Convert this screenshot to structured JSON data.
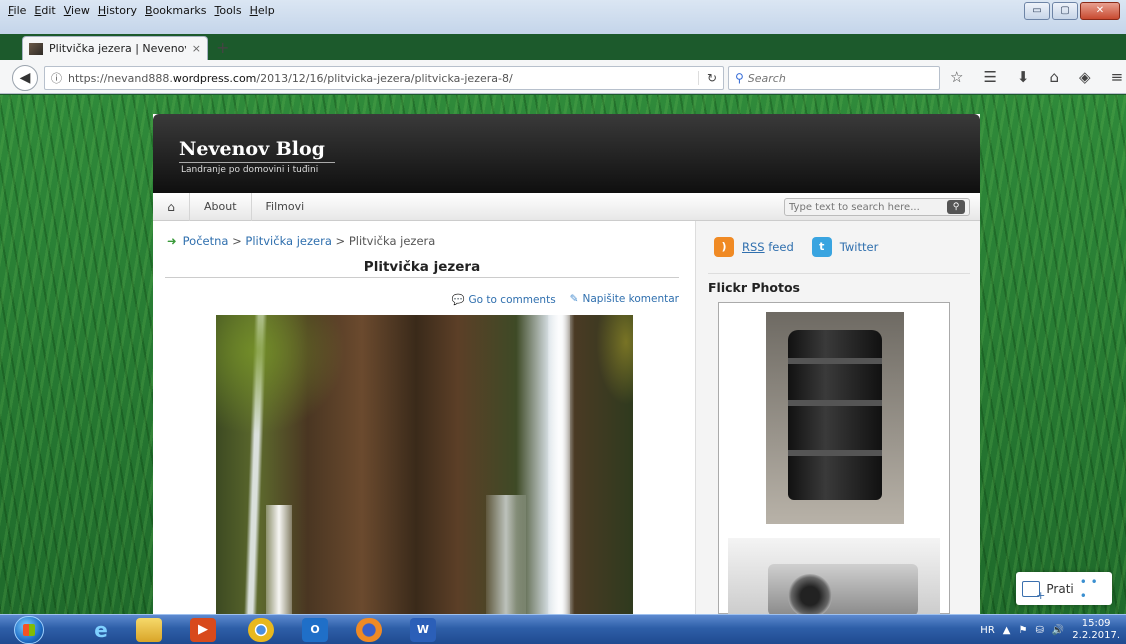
{
  "browser": {
    "menu": [
      "File",
      "Edit",
      "View",
      "History",
      "Bookmarks",
      "Tools",
      "Help"
    ],
    "tab_title": "Plitvička jezera | Nevenov B...",
    "tab_close": "×",
    "new_tab": "+",
    "url_prefix": "https://nevand888.",
    "url_domain": "wordpress.com",
    "url_path": "/2013/12/16/plitvicka-jezera/plitvicka-jezera-8/",
    "search_placeholder": "Search",
    "window_buttons": [
      "▭",
      "▢",
      "✕"
    ]
  },
  "blog": {
    "title": "Nevenov Blog",
    "tagline": "Landranje po domovini i tuđini",
    "nav": [
      "About",
      "Filmovi"
    ],
    "search_placeholder": "Type text to search here...",
    "breadcrumb": {
      "home": "Početna",
      "parent": "Plitvička jezera",
      "current": "Plitvička jezera",
      "sep": ">"
    },
    "post_title": "Plitvička jezera",
    "go_to_comments": "Go to comments",
    "write_comment": "Napišite komentar"
  },
  "sidebar": {
    "rss_abbr": "RSS",
    "rss_rest": " feed",
    "twitter": "Twitter",
    "flickr_title": "Flickr Photos"
  },
  "follow": {
    "label": "Prati",
    "more": "• • •"
  },
  "taskbar": {
    "lang": "HR",
    "time": "15:09",
    "date": "2.2.2017."
  },
  "colors": {
    "link": "#2f6fae",
    "header_dark": "#1a1a1a",
    "grass": "#2f8a3a",
    "taskbar": "#2e5fa8"
  }
}
